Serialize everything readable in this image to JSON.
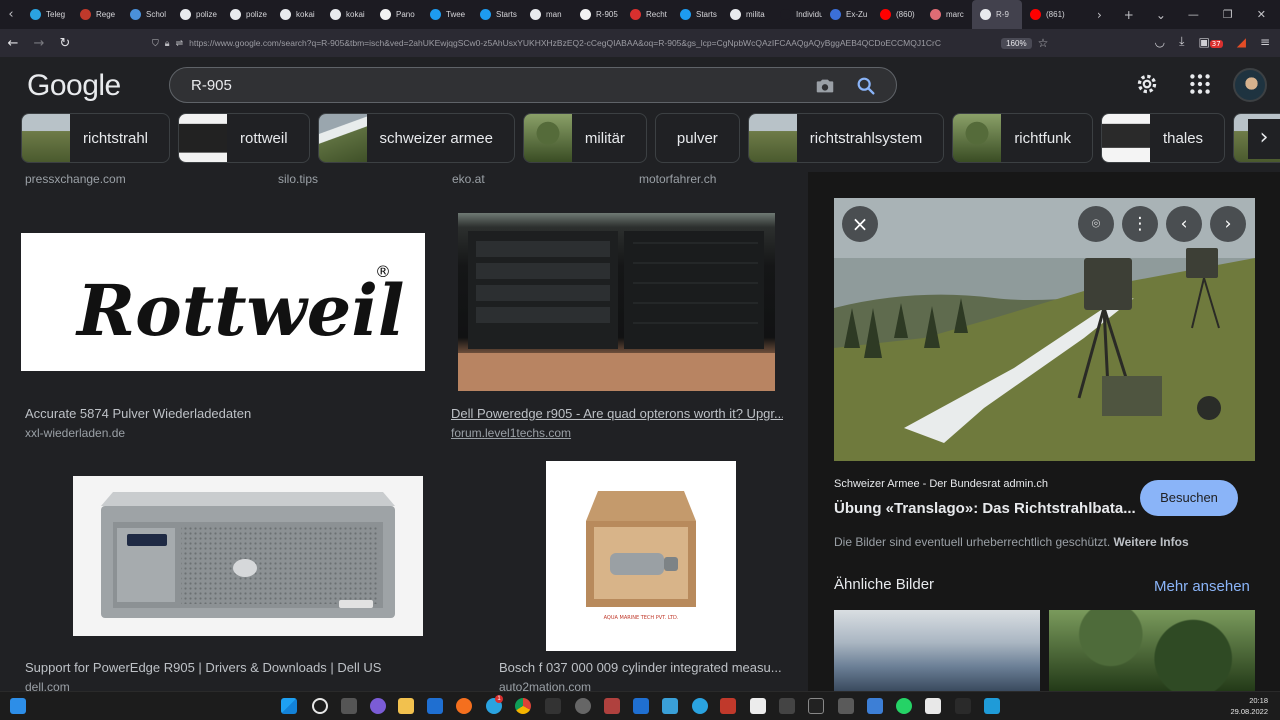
{
  "browser": {
    "tabs": [
      {
        "label": "Teleg",
        "color": "#2aa3e0"
      },
      {
        "label": "Rege",
        "color": "#c0392b"
      },
      {
        "label": "Schol",
        "color": "#4a90d9"
      },
      {
        "label": "polize",
        "color": "#e8eaed"
      },
      {
        "label": "polize",
        "color": "#e8eaed"
      },
      {
        "label": "kokai",
        "color": "#e8eaed"
      },
      {
        "label": "kokai",
        "color": "#e8eaed"
      },
      {
        "label": "Pano",
        "color": "#f2f2f2"
      },
      {
        "label": "Twee",
        "color": "#1d9bf0"
      },
      {
        "label": "Starts",
        "color": "#1d9bf0"
      },
      {
        "label": "man",
        "color": "#e8eaed"
      },
      {
        "label": "R-905",
        "color": "#f2f2f2"
      },
      {
        "label": "Recht",
        "color": "#d9302f"
      },
      {
        "label": "Starts",
        "color": "#1d9bf0"
      },
      {
        "label": "milita",
        "color": "#e8eaed"
      },
      {
        "label": "Individue",
        "color": "#1c1b22"
      },
      {
        "label": "Ex-Zu",
        "color": "#3b6fd8"
      },
      {
        "label": "(860)",
        "color": "#ff0000"
      },
      {
        "label": "marc",
        "color": "#e06c75"
      },
      {
        "label": "R-9",
        "color": "#e8eaed"
      },
      {
        "label": "(861)",
        "color": "#ff0000"
      }
    ],
    "active_tab_index": 19,
    "url": "https://www.google.com/search?q=R-905&tbm=isch&ved=2ahUKEwjqgSCw0-z5AhUsxYUKHXHzBzEQ2-cCegQIABAA&oq=R-905&gs_lcp=CgNpbWcQAzIFCAAQgAQyBggAEB4QCDoECCMQJ1CrC",
    "zoom": "160%",
    "download_badge": "37"
  },
  "search": {
    "logo": "Google",
    "query": "R-905"
  },
  "chips": [
    {
      "label": "richtstrahl",
      "thumb": "field"
    },
    {
      "label": "rottweil",
      "thumb": "box"
    },
    {
      "label": "schweizer armee",
      "thumb": "hill"
    },
    {
      "label": "militär",
      "thumb": "soldier"
    },
    {
      "label": "pulver",
      "thumb": ""
    },
    {
      "label": "richtstrahlsystem",
      "thumb": "field"
    },
    {
      "label": "richtfunk",
      "thumb": "soldier"
    },
    {
      "label": "thales",
      "thumb": "device"
    },
    {
      "label": "",
      "thumb": "field"
    }
  ],
  "results": {
    "top_sources": [
      "pressxchange.com",
      "silo.tips",
      "eko.at",
      "motorfahrer.ch"
    ],
    "cards": [
      {
        "title": "Accurate 5874 Pulver Wiederladedaten",
        "domain": "xxl-wiederladen.de",
        "logo_text": "Rottweil",
        "logo_mark": "®"
      },
      {
        "title": "Dell Poweredge r905 - Are quad opterons worth it? Upgr...",
        "domain": "forum.level1techs.com"
      },
      {
        "title": "Support for PowerEdge R905 | Drivers & Downloads | Dell US",
        "domain": "dell.com"
      },
      {
        "title": "Bosch f 037 000 009 cylinder integrated measu...",
        "domain": "auto2mation.com"
      }
    ]
  },
  "preview": {
    "source": "Schweizer Armee - Der Bundesrat admin.ch",
    "title": "Übung «Translago»: Das Richtstrahlbata...",
    "visit_label": "Besuchen",
    "copyright_text": "Die Bilder sind eventuell urheberrechtlich geschützt.",
    "more_info_label": "Weitere Infos",
    "similar_heading": "Ähnliche Bilder",
    "more_label": "Mehr ansehen"
  },
  "taskbar": {
    "time": "20:18",
    "date": "29.08.2022",
    "notification_badge": "1"
  }
}
